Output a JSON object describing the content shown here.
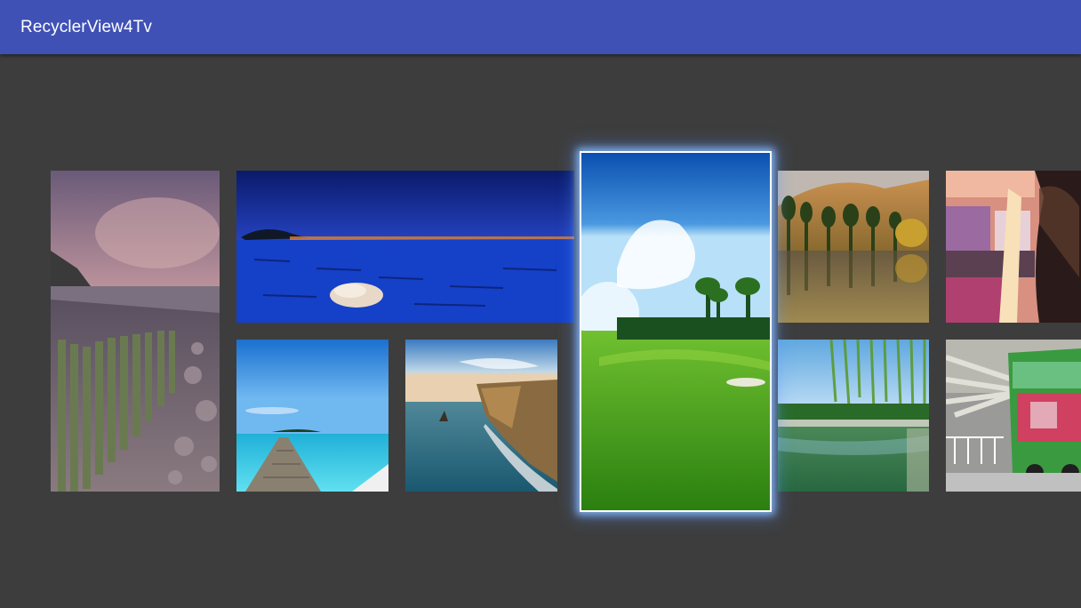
{
  "app_bar": {
    "title": "RecyclerView4Tv",
    "color": "#3f51b5"
  },
  "grid": {
    "background": "#3d3d3d",
    "focused_item_index": 4,
    "items": [
      {
        "name": "stone-beach-sunset-photo"
      },
      {
        "name": "blue-sea-shell-photo"
      },
      {
        "name": "tropical-pier-photo"
      },
      {
        "name": "sea-cliff-photo"
      },
      {
        "name": "golf-course-photo"
      },
      {
        "name": "autumn-lake-photo"
      },
      {
        "name": "pink-interior-photo"
      },
      {
        "name": "willow-pond-photo"
      },
      {
        "name": "green-bus-photo"
      }
    ]
  }
}
